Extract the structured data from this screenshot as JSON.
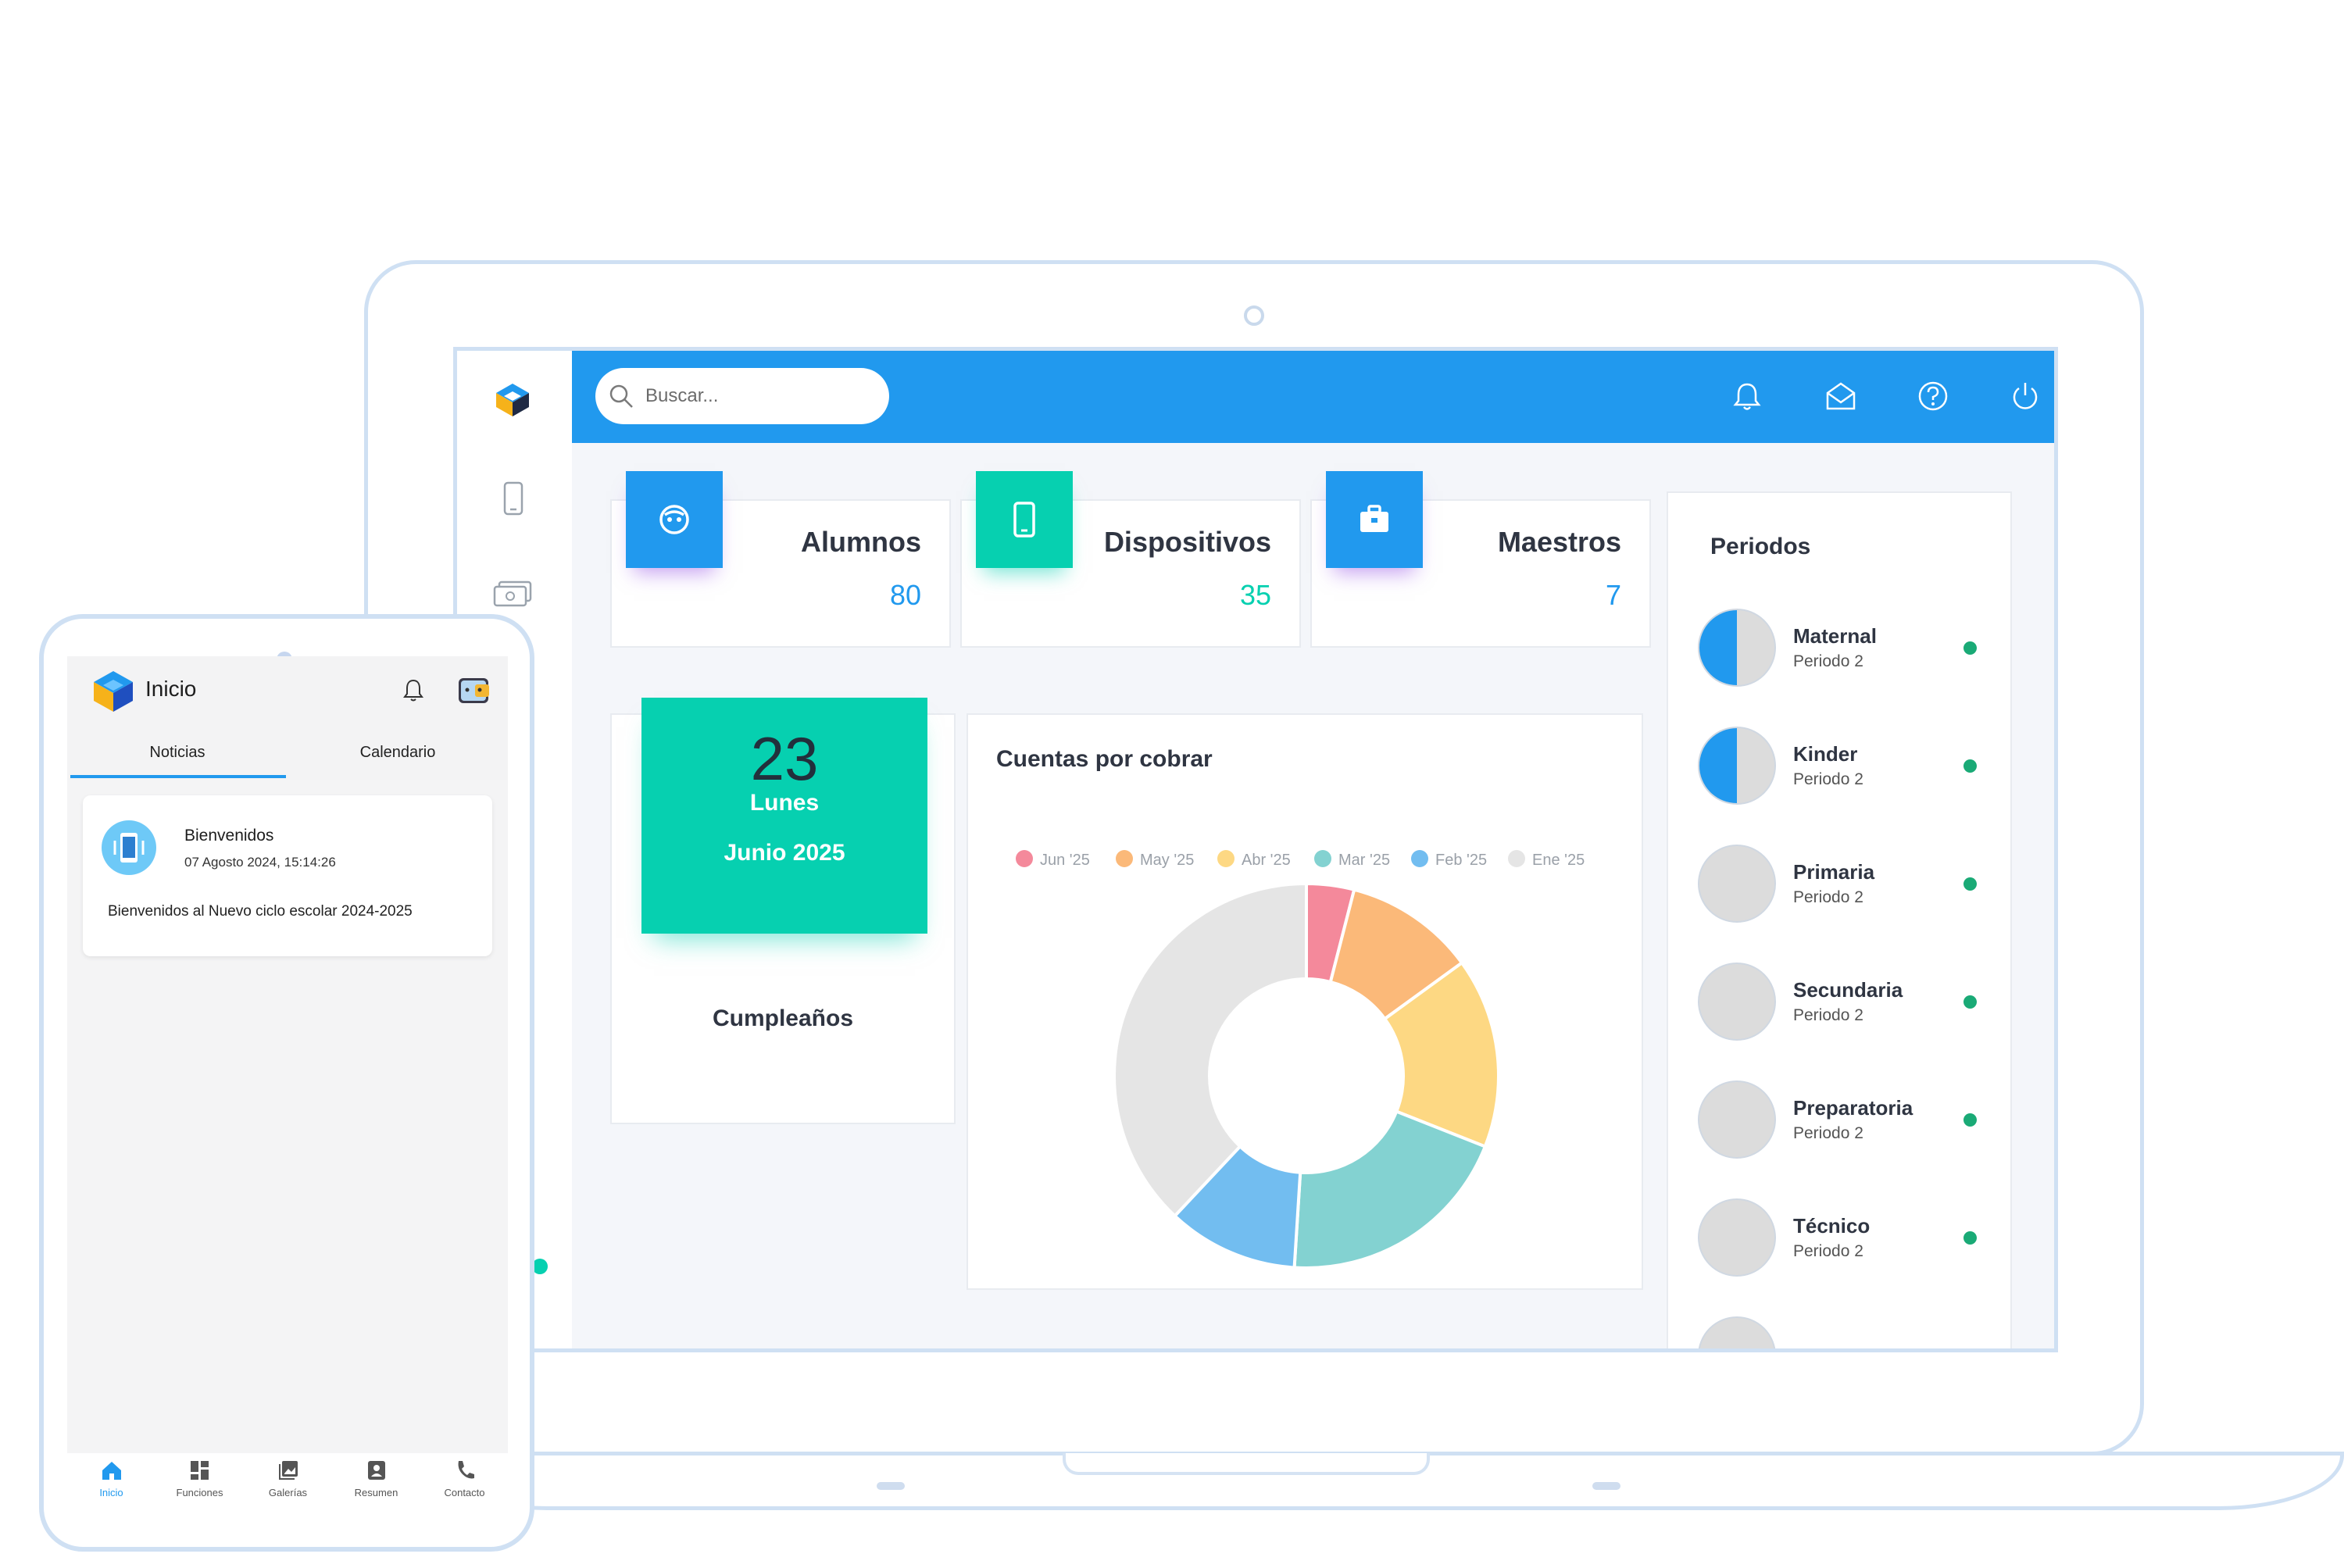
{
  "search": {
    "placeholder": "Buscar..."
  },
  "stats": [
    {
      "title": "Alumnos",
      "value": "80",
      "color": "#2199ee",
      "icon": "face-icon"
    },
    {
      "title": "Dispositivos",
      "value": "35",
      "color": "#06d0b0",
      "icon": "smartphone-icon"
    },
    {
      "title": "Maestros",
      "value": "7",
      "color": "#2199ee",
      "icon": "briefcase-icon"
    }
  ],
  "date_card": {
    "day": "23",
    "weekday": "Lunes",
    "month_year": "Junio 2025",
    "color": "#06d0b0"
  },
  "birthdays": {
    "title": "Cumpleaños"
  },
  "periods": {
    "title": "Periodos",
    "items": [
      {
        "name": "Maternal",
        "sub": "Periodo 2",
        "progress": 0.5
      },
      {
        "name": "Kinder",
        "sub": "Periodo 2",
        "progress": 0.5
      },
      {
        "name": "Primaria",
        "sub": "Periodo 2",
        "progress": 0
      },
      {
        "name": "Secundaria",
        "sub": "Periodo 2",
        "progress": 0
      },
      {
        "name": "Preparatoria",
        "sub": "Periodo 2",
        "progress": 0
      },
      {
        "name": "Técnico",
        "sub": "Periodo 2",
        "progress": 0
      }
    ]
  },
  "chart_data": {
    "type": "pie",
    "title": "Cuentas por cobrar",
    "categories": [
      "Jun '25",
      "May '25",
      "Abr '25",
      "Mar '25",
      "Feb '25",
      "Ene '25"
    ],
    "values": [
      4,
      11,
      16,
      20,
      11,
      38
    ],
    "colors": [
      "#f4899b",
      "#fbb979",
      "#fdd883",
      "#83d2d1",
      "#72bdf0",
      "#e5e5e5"
    ],
    "legend": "top"
  },
  "phone": {
    "title": "Inicio",
    "tabs": [
      "Noticias",
      "Calendario"
    ],
    "news": {
      "title": "Bienvenidos",
      "date": "07 Agosto 2024, 15:14:26",
      "body": "Bienvenidos al Nuevo ciclo escolar 2024-2025"
    },
    "nav": [
      "Inicio",
      "Funciones",
      "Galerías",
      "Resumen",
      "Contacto"
    ],
    "accent": "#2199ee"
  }
}
